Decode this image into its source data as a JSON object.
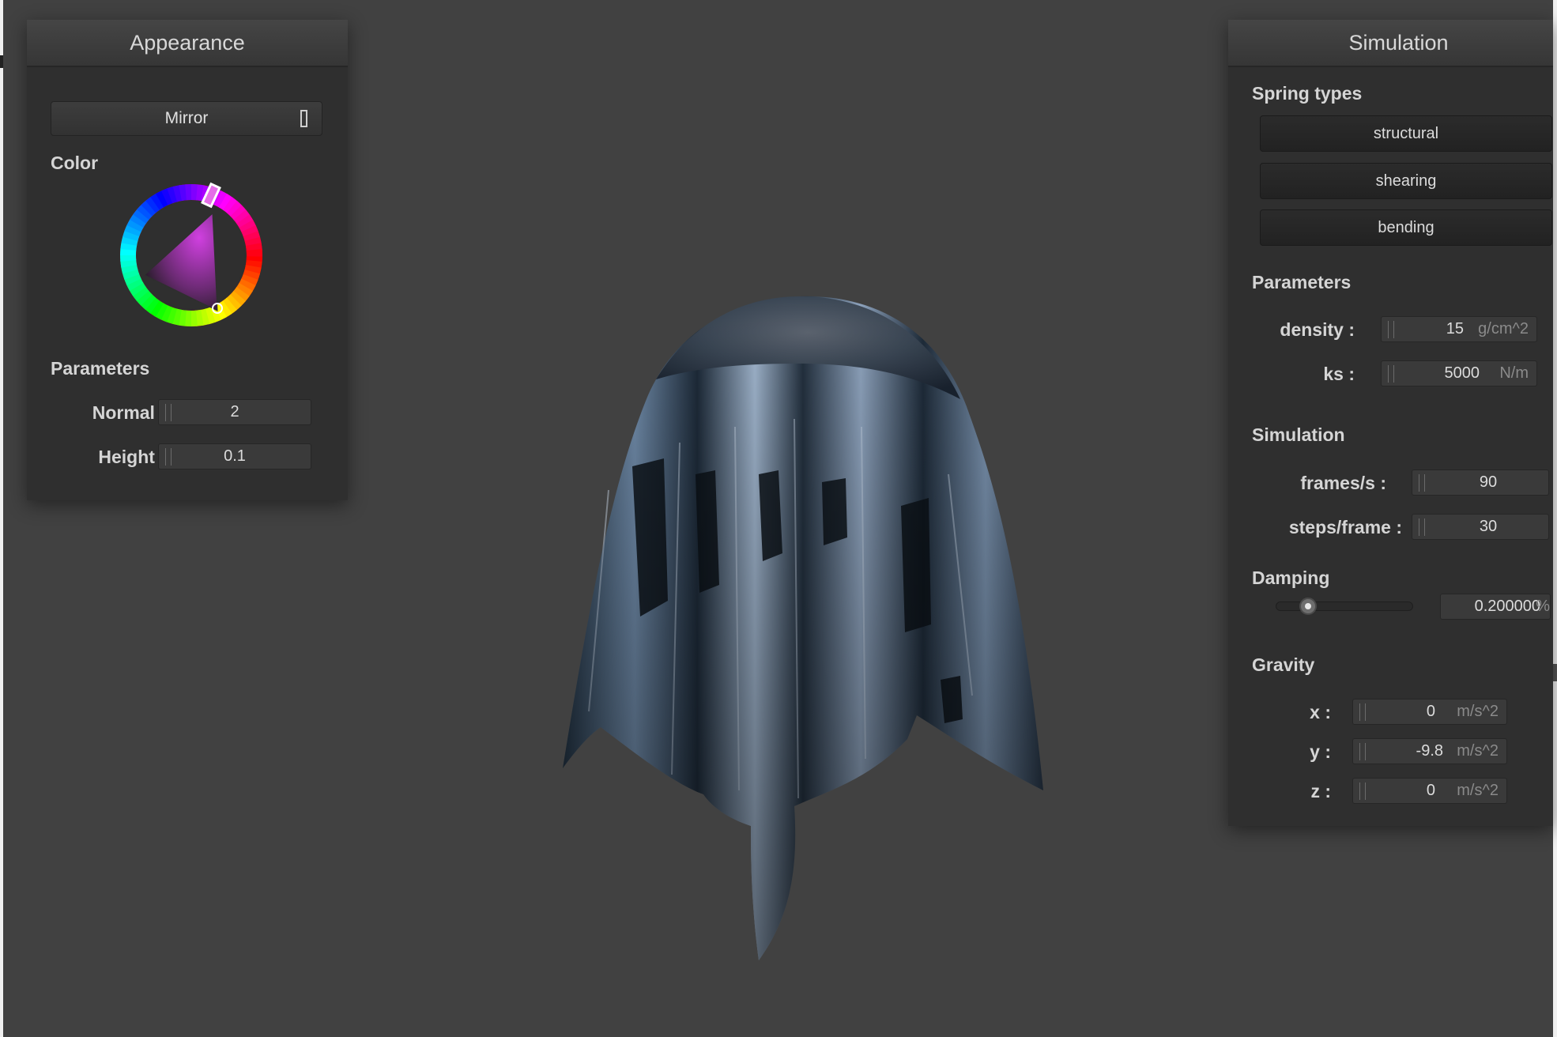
{
  "appearance": {
    "title": "Appearance",
    "material": "Mirror",
    "color_label": "Color",
    "color_hex": "#c040d0",
    "parameters_label": "Parameters",
    "normal_label": "Normal :",
    "normal_value": "2",
    "height_label": "Height :",
    "height_value": "0.1"
  },
  "simulation": {
    "title": "Simulation",
    "spring_types_label": "Spring types",
    "spring_types": [
      "structural",
      "shearing",
      "bending"
    ],
    "parameters_label": "Parameters",
    "density_label": "density :",
    "density_value": "15",
    "density_unit": "g/cm^2",
    "ks_label": "ks :",
    "ks_value": "5000",
    "ks_unit": "N/m",
    "simulation_label": "Simulation",
    "fps_label": "frames/s :",
    "fps_value": "90",
    "steps_label": "steps/frame :",
    "steps_value": "30",
    "damping_label": "Damping",
    "damping_value": "0.200000",
    "damping_unit": "%",
    "damping_fraction": 0.2,
    "gravity_label": "Gravity",
    "gx_label": "x :",
    "gx_value": "0",
    "gy_label": "y :",
    "gy_value": "-9.8",
    "gz_label": "z :",
    "gz_value": "0",
    "gravity_unit": "m/s^2"
  },
  "colors": {
    "background": "#414141",
    "panel": "#2f2f2f",
    "cloth_dark": "#1e2a38",
    "cloth_light": "#8fa6c4"
  }
}
